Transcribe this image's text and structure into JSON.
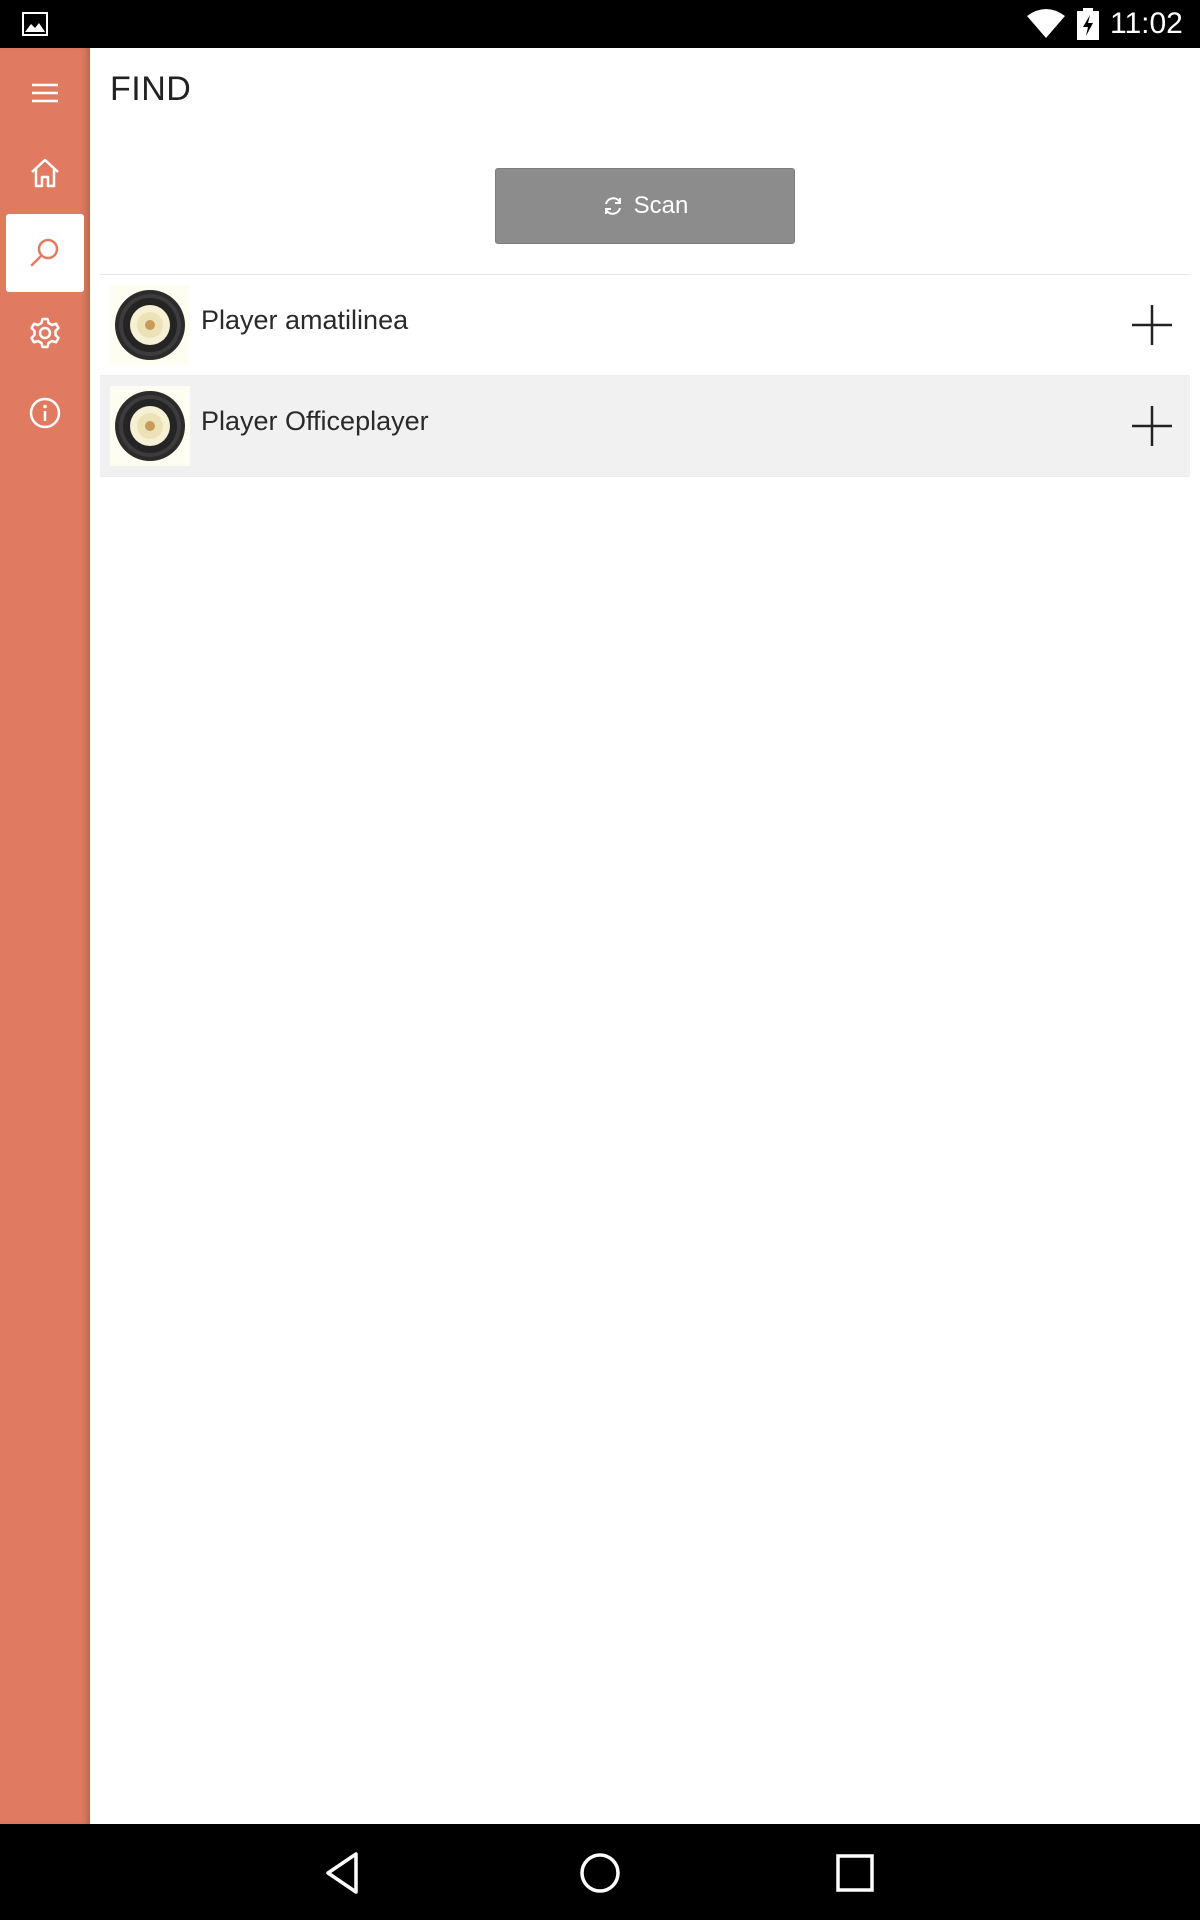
{
  "status_bar": {
    "time": "11:02",
    "icons": [
      "image-notification-icon",
      "wifi-icon",
      "battery-charging-icon"
    ]
  },
  "side_rail": {
    "background_color": "#e07b62",
    "items": [
      {
        "name": "menu",
        "icon": "hamburger-menu-icon",
        "active": false
      },
      {
        "name": "home",
        "icon": "home-icon",
        "active": false
      },
      {
        "name": "find",
        "icon": "search-icon",
        "active": true
      },
      {
        "name": "settings",
        "icon": "gear-icon",
        "active": false
      },
      {
        "name": "info",
        "icon": "info-icon",
        "active": false
      }
    ]
  },
  "main": {
    "title": "FIND",
    "scan_button": {
      "label": "Scan",
      "icon": "refresh-icon",
      "color": "#8c8c8c"
    },
    "players": [
      {
        "name": "Player amatilinea",
        "icon": "vinyl-record-icon",
        "action_icon": "plus-icon"
      },
      {
        "name": "Player Officeplayer",
        "icon": "vinyl-record-icon",
        "action_icon": "plus-icon"
      }
    ]
  },
  "nav_bar": {
    "buttons": [
      "back-icon",
      "home-circle-icon",
      "recents-icon"
    ]
  }
}
